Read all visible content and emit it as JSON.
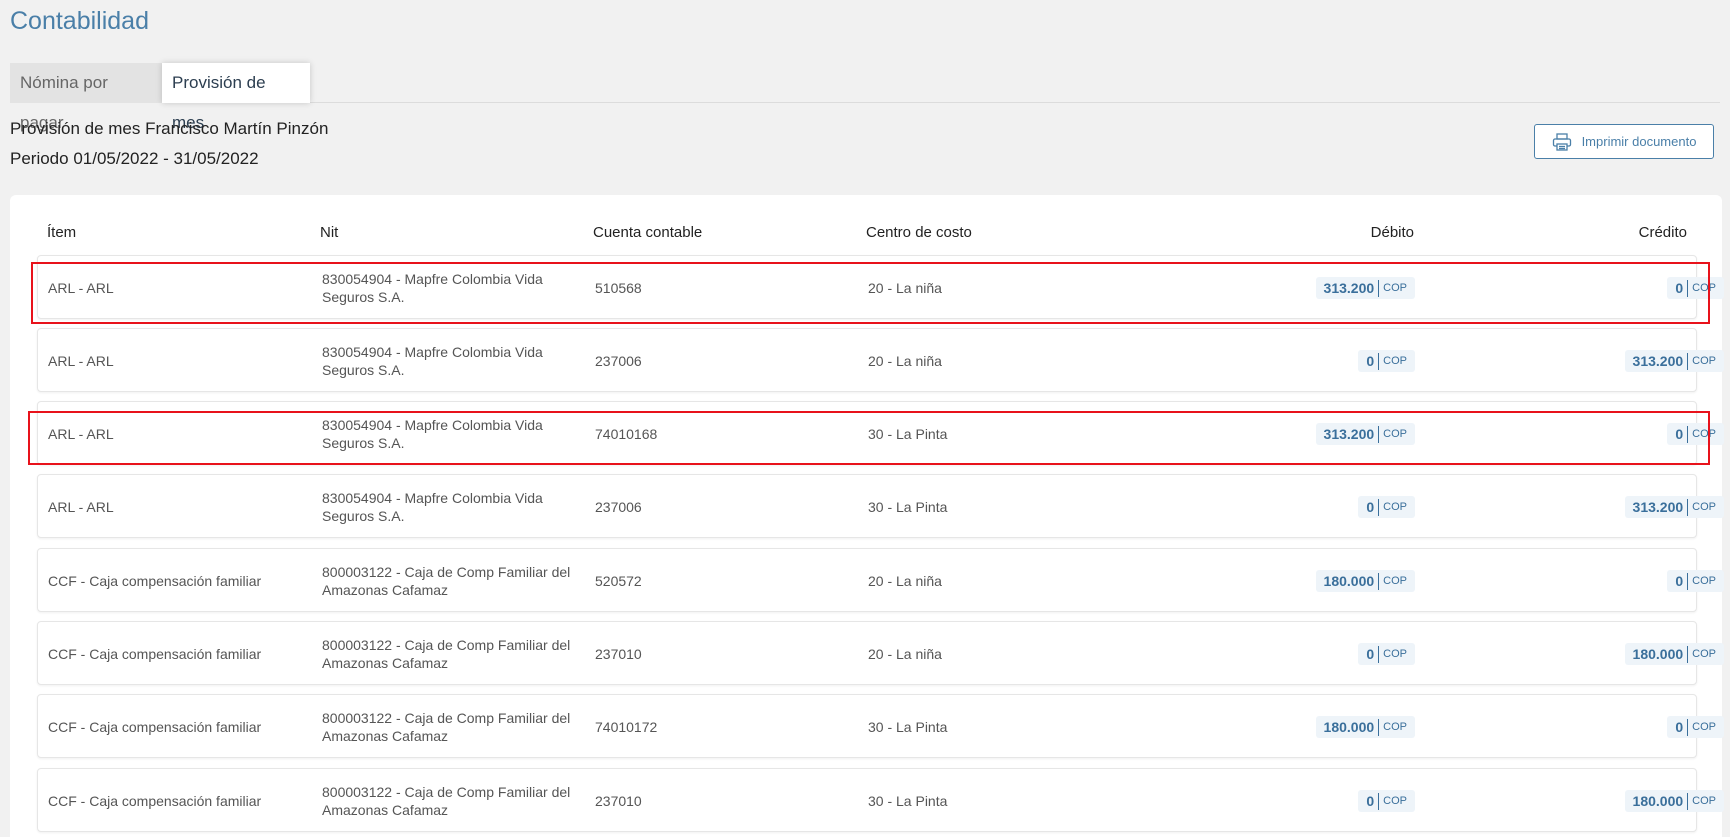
{
  "page": {
    "title": "Contabilidad"
  },
  "tabs": [
    {
      "label": "Nómina por pagar",
      "active": false
    },
    {
      "label": "Provisión de mes",
      "active": true
    }
  ],
  "header": {
    "line1": "Provisión de mes Francisco Martín Pinzón",
    "line2": "Periodo 01/05/2022 - 31/05/2022"
  },
  "print_button": {
    "label": "Imprimir documento",
    "icon": "printer-icon"
  },
  "table": {
    "columns": [
      "Ítem",
      "Nit",
      "Cuenta contable",
      "Centro de costo",
      "Débito",
      "Crédito"
    ],
    "currency": "COP",
    "rows": [
      {
        "item": "ARL - ARL",
        "nit": "830054904 - Mapfre Colombia Vida Seguros S.A.",
        "cuenta": "510568",
        "centro": "20 - La niña",
        "debito": "313.200",
        "credito": "0",
        "highlighted": true
      },
      {
        "item": "ARL - ARL",
        "nit": "830054904 - Mapfre Colombia Vida Seguros S.A.",
        "cuenta": "237006",
        "centro": "20 - La niña",
        "debito": "0",
        "credito": "313.200",
        "highlighted": false
      },
      {
        "item": "ARL - ARL",
        "nit": "830054904 - Mapfre Colombia Vida Seguros S.A.",
        "cuenta": "74010168",
        "centro": "30 - La Pinta",
        "debito": "313.200",
        "credito": "0",
        "highlighted": true
      },
      {
        "item": "ARL - ARL",
        "nit": "830054904 - Mapfre Colombia Vida Seguros S.A.",
        "cuenta": "237006",
        "centro": "30 - La Pinta",
        "debito": "0",
        "credito": "313.200",
        "highlighted": false
      },
      {
        "item": "CCF - Caja compensación familiar",
        "nit": "800003122 - Caja de Comp Familiar del Amazonas Cafamaz",
        "cuenta": "520572",
        "centro": "20 - La niña",
        "debito": "180.000",
        "credito": "0",
        "highlighted": false
      },
      {
        "item": "CCF - Caja compensación familiar",
        "nit": "800003122 - Caja de Comp Familiar del Amazonas Cafamaz",
        "cuenta": "237010",
        "centro": "20 - La niña",
        "debito": "0",
        "credito": "180.000",
        "highlighted": false
      },
      {
        "item": "CCF - Caja compensación familiar",
        "nit": "800003122 - Caja de Comp Familiar del Amazonas Cafamaz",
        "cuenta": "74010172",
        "centro": "30 - La Pinta",
        "debito": "180.000",
        "credito": "0",
        "highlighted": false
      },
      {
        "item": "CCF - Caja compensación familiar",
        "nit": "800003122 - Caja de Comp Familiar del Amazonas Cafamaz",
        "cuenta": "237010",
        "centro": "30 - La Pinta",
        "debito": "0",
        "credito": "180.000",
        "highlighted": false
      }
    ]
  },
  "colors": {
    "accent": "#4a7fa8",
    "amount": "#3a6f9b",
    "amount_bg": "#eef4f9",
    "highlight": "#e8121b"
  }
}
